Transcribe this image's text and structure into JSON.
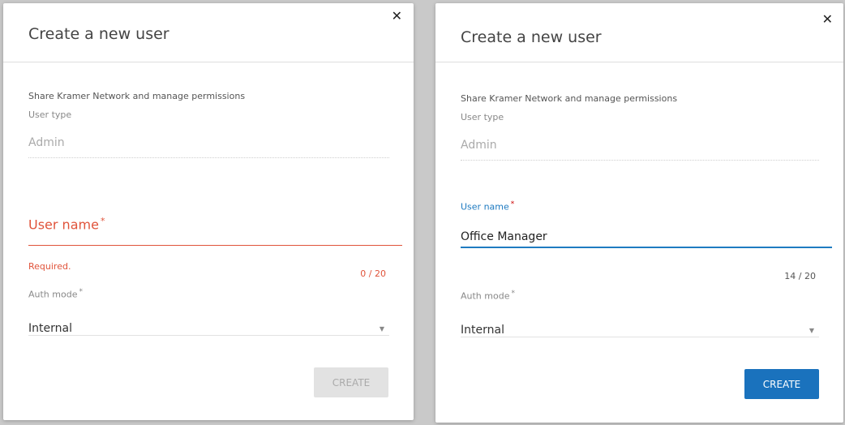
{
  "dialogs": [
    {
      "title": "Create a new user",
      "close_icon": "close-icon",
      "subtitle": "Share Kramer Network and manage permissions",
      "user_type": {
        "label": "User type",
        "value": "Admin"
      },
      "user_name": {
        "label": "User name",
        "required_mark": "*",
        "value": "",
        "error": "Required.",
        "counter": "0 / 20",
        "state": "error"
      },
      "auth_mode": {
        "label": "Auth mode",
        "required_mark": "*",
        "value": "Internal"
      },
      "create_label": "CREATE",
      "create_enabled": false
    },
    {
      "title": "Create a new user",
      "close_icon": "close-icon",
      "subtitle": "Share Kramer Network and manage permissions",
      "user_type": {
        "label": "User type",
        "value": "Admin"
      },
      "user_name": {
        "label": "User name",
        "required_mark": "*",
        "value": "Office Manager",
        "counter": "14 / 20",
        "state": "focused"
      },
      "auth_mode": {
        "label": "Auth mode",
        "required_mark": "*",
        "value": "Internal"
      },
      "create_label": "CREATE",
      "create_enabled": true
    }
  ],
  "colors": {
    "error": "#e0533a",
    "accent": "#1f7bc1",
    "primary_button": "#1a72bd",
    "disabled_button": "#e2e2e2"
  }
}
